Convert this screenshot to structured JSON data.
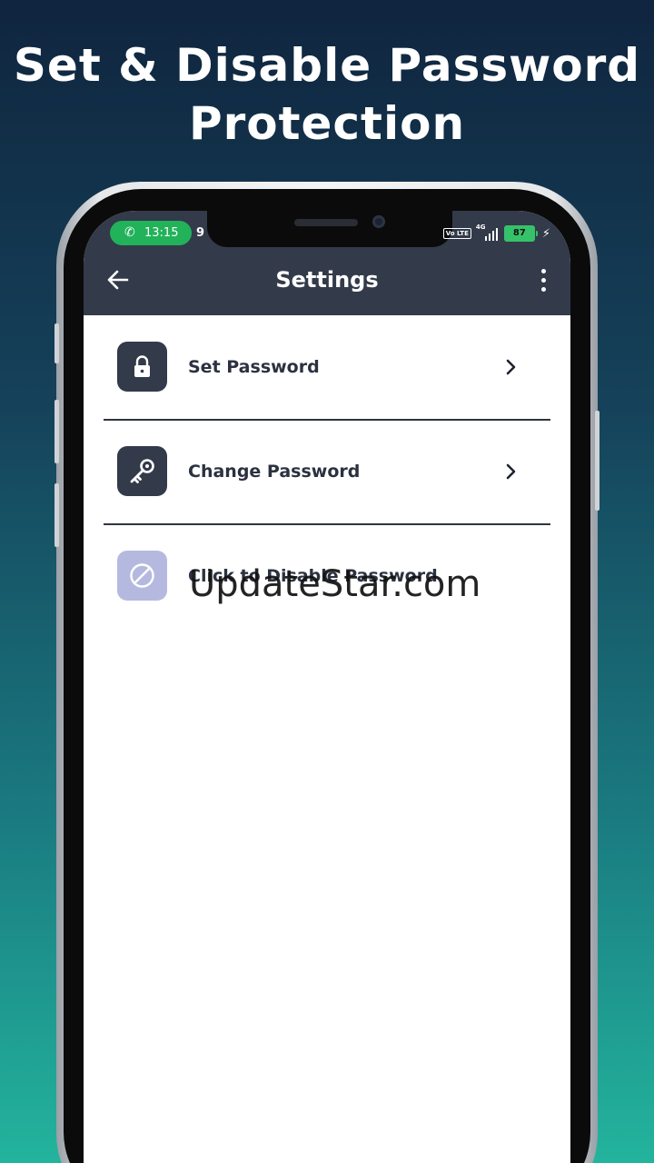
{
  "promo": {
    "headline_line1": "Set & Disable Password",
    "headline_line2": "Protection"
  },
  "status_bar": {
    "call_time": "13:15",
    "time_clip": "9",
    "network": "4G",
    "volte": "Vo LTE",
    "battery_percent": "87"
  },
  "app_bar": {
    "title": "Settings",
    "back_icon": "arrow-left-icon",
    "menu_icon": "more-vertical-icon"
  },
  "settings": {
    "items": [
      {
        "label": "Set Password",
        "icon": "lock-icon",
        "enabled": true
      },
      {
        "label": "Change Password",
        "icon": "key-icon",
        "enabled": true
      },
      {
        "label": "Click to Disable Password",
        "icon": "block-icon",
        "enabled": false
      }
    ]
  },
  "watermark": "UpdateStar.com",
  "colors": {
    "app_bar": "#333a4a",
    "icon_tile": "#333a4a",
    "icon_tile_disabled": "#b6b9df",
    "call_pill": "#22b25a",
    "battery": "#36c26b"
  }
}
